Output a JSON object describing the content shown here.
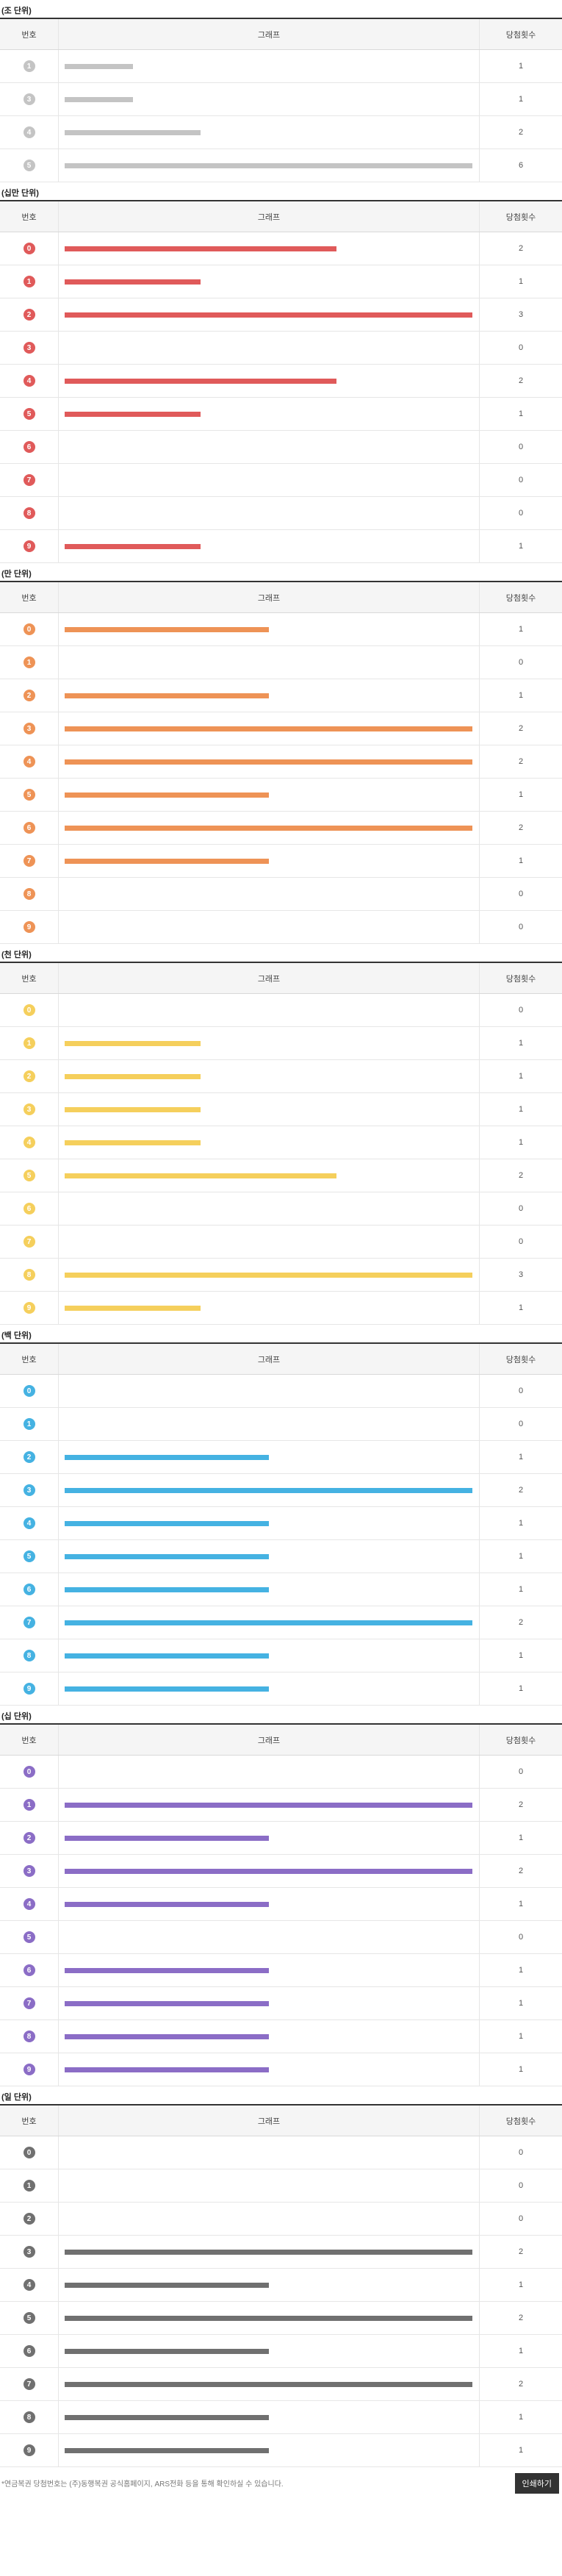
{
  "header_labels": {
    "number": "번호",
    "graph": "그래프",
    "count": "당첨횟수"
  },
  "footer": {
    "note": "*연금복권 당첨번호는 (주)동행복권 공식홈페이지, ARS전화 등을 통해 확인하실 수 있습니다.",
    "print_button": "인쇄하기"
  },
  "chart_data": [
    {
      "type": "bar",
      "title": "(조 단위)",
      "color": "#c4c4c4",
      "categories": [
        "1",
        "3",
        "4",
        "5"
      ],
      "values": [
        1,
        1,
        2,
        6
      ],
      "xlim": [
        0,
        6
      ]
    },
    {
      "type": "bar",
      "title": "(십만 단위)",
      "color": "#e05a5a",
      "categories": [
        "0",
        "1",
        "2",
        "3",
        "4",
        "5",
        "6",
        "7",
        "8",
        "9"
      ],
      "values": [
        2,
        1,
        3,
        0,
        2,
        1,
        0,
        0,
        0,
        1
      ],
      "xlim": [
        0,
        3
      ]
    },
    {
      "type": "bar",
      "title": "(만 단위)",
      "color": "#ee9356",
      "categories": [
        "0",
        "1",
        "2",
        "3",
        "4",
        "5",
        "6",
        "7",
        "8",
        "9"
      ],
      "values": [
        1,
        0,
        1,
        2,
        2,
        1,
        2,
        1,
        0,
        0
      ],
      "xlim": [
        0,
        2
      ]
    },
    {
      "type": "bar",
      "title": "(천 단위)",
      "color": "#f5cf5c",
      "categories": [
        "0",
        "1",
        "2",
        "3",
        "4",
        "5",
        "6",
        "7",
        "8",
        "9"
      ],
      "values": [
        0,
        1,
        1,
        1,
        1,
        2,
        0,
        0,
        3,
        1
      ],
      "xlim": [
        0,
        3
      ]
    },
    {
      "type": "bar",
      "title": "(백 단위)",
      "color": "#45b2e2",
      "categories": [
        "0",
        "1",
        "2",
        "3",
        "4",
        "5",
        "6",
        "7",
        "8",
        "9"
      ],
      "values": [
        0,
        0,
        1,
        2,
        1,
        1,
        1,
        2,
        1,
        1
      ],
      "xlim": [
        0,
        2
      ]
    },
    {
      "type": "bar",
      "title": "(십 단위)",
      "color": "#8b6dc6",
      "categories": [
        "0",
        "1",
        "2",
        "3",
        "4",
        "5",
        "6",
        "7",
        "8",
        "9"
      ],
      "values": [
        0,
        2,
        1,
        2,
        1,
        0,
        1,
        1,
        1,
        1
      ],
      "xlim": [
        0,
        2
      ]
    },
    {
      "type": "bar",
      "title": "(일 단위)",
      "color": "#707070",
      "categories": [
        "0",
        "1",
        "2",
        "3",
        "4",
        "5",
        "6",
        "7",
        "8",
        "9"
      ],
      "values": [
        0,
        0,
        0,
        2,
        1,
        2,
        1,
        2,
        1,
        1
      ],
      "xlim": [
        0,
        2
      ]
    }
  ]
}
